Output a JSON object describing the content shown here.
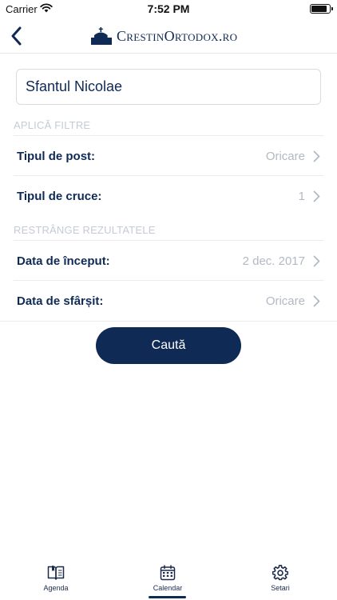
{
  "status_bar": {
    "carrier": "Carrier",
    "time": "7:52 PM",
    "battery_level": 0.9
  },
  "nav": {
    "back_icon": "chevron-left-icon",
    "logo_icon": "church-icon",
    "logo_text": "CrestinOrtodox.ro"
  },
  "search": {
    "value": "Sfantul Nicolae"
  },
  "filters": {
    "header": "APLICĂ FILTRE",
    "fast_type_label": "Tipul de post:",
    "fast_type_value": "Oricare",
    "cross_type_label": "Tipul de cruce:",
    "cross_type_value": "1"
  },
  "restrict": {
    "header": "RESTRÂNGE REZULTATELE",
    "start_date_label": "Data de început:",
    "start_date_value": "2 dec. 2017",
    "end_date_label": "Data de sfârșit:",
    "end_date_value": "Oricare"
  },
  "search_button_label": "Caută",
  "tabs": [
    {
      "label": "Agenda",
      "icon": "book-icon",
      "active": false
    },
    {
      "label": "Calendar",
      "icon": "calendar-icon",
      "active": true
    },
    {
      "label": "Setari",
      "icon": "gear-icon",
      "active": false
    }
  ],
  "colors": {
    "brand": "#0f2a55",
    "muted": "#b3b9c4",
    "section_header": "#c5cbd6"
  }
}
